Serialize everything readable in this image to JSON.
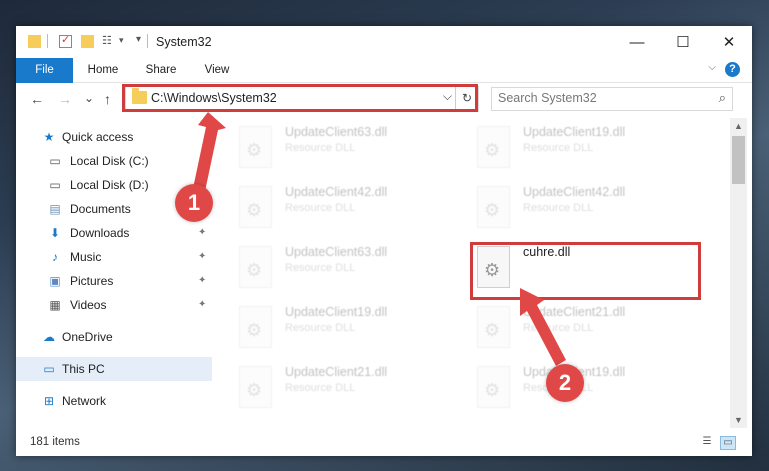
{
  "window": {
    "title": "System32",
    "controls": {
      "minimize": "—",
      "maximize": "☐",
      "close": "✕"
    }
  },
  "ribbon": {
    "tabs": [
      "File",
      "Home",
      "Share",
      "View"
    ],
    "help_label": "?",
    "expand_label": "⌵"
  },
  "navbar": {
    "back": "←",
    "forward": "→",
    "recent": "⌄",
    "up": "↑",
    "address": "C:\\Windows\\System32",
    "address_dropdown": "⌵",
    "refresh": "↻",
    "search_placeholder": "Search System32",
    "search_icon": "⌕"
  },
  "nav_pane": {
    "items": [
      {
        "label": "Quick access",
        "icon": "star-icon",
        "pinned": false
      },
      {
        "label": "Local Disk (C:)",
        "icon": "drive-icon",
        "pinned": false
      },
      {
        "label": "Local Disk (D:)",
        "icon": "drive-icon",
        "pinned": false
      },
      {
        "label": "Documents",
        "icon": "documents-icon",
        "pinned": false
      },
      {
        "label": "Downloads",
        "icon": "downloads-icon",
        "pinned": true
      },
      {
        "label": "Music",
        "icon": "music-icon",
        "pinned": true
      },
      {
        "label": "Pictures",
        "icon": "pictures-icon",
        "pinned": true
      },
      {
        "label": "Videos",
        "icon": "videos-icon",
        "pinned": true
      },
      {
        "label": "OneDrive",
        "icon": "cloud-icon",
        "pinned": false
      },
      {
        "label": "This PC",
        "icon": "computer-icon",
        "pinned": false,
        "selected": true
      },
      {
        "label": "Network",
        "icon": "network-icon",
        "pinned": false
      }
    ],
    "pin_glyph": "📌"
  },
  "files": [
    {
      "name": "UpdateClient63.dll",
      "type": "Resource DLL",
      "highlighted": false
    },
    {
      "name": "UpdateClient19.dll",
      "type": "Resource DLL",
      "highlighted": false
    },
    {
      "name": "UpdateClient42.dll",
      "type": "Resource DLL",
      "highlighted": false
    },
    {
      "name": "UpdateClient42.dll",
      "type": "Resource DLL",
      "highlighted": false
    },
    {
      "name": "UpdateClient63.dll",
      "type": "Resource DLL",
      "highlighted": false
    },
    {
      "name": "cuhre.dll",
      "type": "",
      "highlighted": true
    },
    {
      "name": "UpdateClient19.dll",
      "type": "Resource DLL",
      "highlighted": false
    },
    {
      "name": "UpdateClient21.dll",
      "type": "Resource DLL",
      "highlighted": false
    },
    {
      "name": "UpdateClient21.dll",
      "type": "Resource DLL",
      "highlighted": false
    },
    {
      "name": "UpdateClient19.dll",
      "type": "Resource DLL",
      "highlighted": false
    }
  ],
  "status": {
    "item_count": "181 items"
  },
  "annotations": {
    "step1": "1",
    "step2": "2",
    "color": "#e04848"
  }
}
